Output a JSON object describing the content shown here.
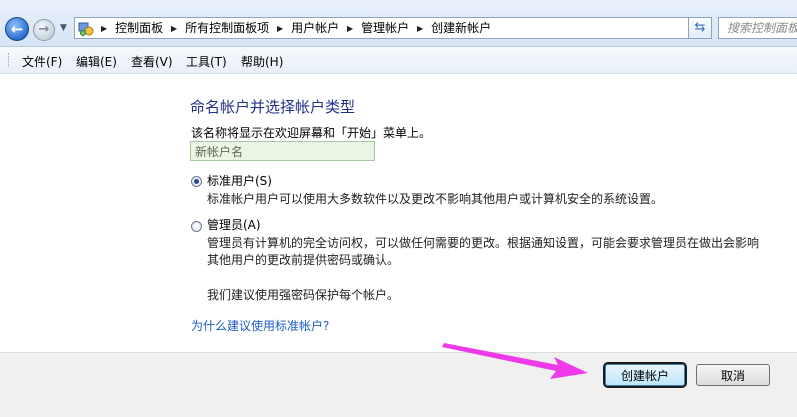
{
  "address_bar": {
    "breadcrumbs": [
      "控制面板",
      "所有控制面板项",
      "用户帐户",
      "管理帐户",
      "创建新帐户"
    ],
    "search_placeholder": "搜索控制面板"
  },
  "menu": [
    "文件(F)",
    "编辑(E)",
    "查看(V)",
    "工具(T)",
    "帮助(H)"
  ],
  "content": {
    "heading": "命名帐户并选择帐户类型",
    "description": "该名称将显示在欢迎屏幕和「开始」菜单上。",
    "name_input_value": "新帐户名",
    "options": [
      {
        "label": "标准用户(S)",
        "checked": true,
        "lines": [
          "标准帐户用户可以使用大多数软件以及更改不影响其他用户或计算机安全的系统设置。"
        ]
      },
      {
        "label": "管理员(A)",
        "checked": false,
        "lines": [
          "管理员有计算机的完全访问权，可以做任何需要的更改。根据通知设置，可能会要求管理员在做出会影响",
          "其他用户的更改前提供密码或确认。"
        ]
      }
    ],
    "recommendation": "我们建议使用强密码保护每个帐户。",
    "help_link": "为什么建议使用标准帐户?"
  },
  "buttons": {
    "create": "创建帐户",
    "cancel": "取消"
  },
  "colors": {
    "heading": "#1e3287",
    "link": "#1d5bc4",
    "arrow": "#ee3ae8"
  }
}
